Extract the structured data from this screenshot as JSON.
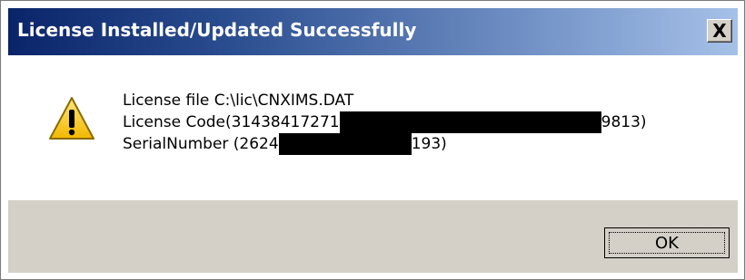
{
  "window": {
    "title": "License Installed/Updated Successfully",
    "close_label": "X"
  },
  "message": {
    "icon": "warning-icon",
    "line1": "License file C:\\lic\\CNXIMS.DAT",
    "line2_prefix": "License Code(31438417271",
    "line2_suffix": "9813)",
    "line3_prefix": "SerialNumber (2624",
    "line3_suffix": "193)"
  },
  "buttons": {
    "ok_label": "OK"
  },
  "colors": {
    "title_start": "#0a246a",
    "title_end": "#a6c1e8",
    "button_face": "#d4d0c8",
    "icon_yellow": "#f5c800"
  }
}
